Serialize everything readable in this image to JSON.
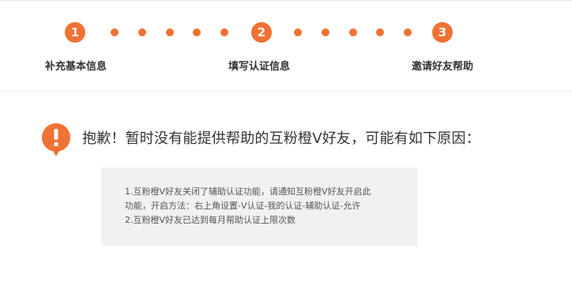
{
  "steps": [
    {
      "number": "1",
      "label": "补充基本信息"
    },
    {
      "number": "2",
      "label": "填写认证信息"
    },
    {
      "number": "3",
      "label": "邀请好友帮助"
    }
  ],
  "colors": {
    "accent": "#f07234",
    "text": "#333333",
    "box_bg": "#f1f1f3"
  },
  "message": {
    "icon": "exclamation-icon",
    "apology": "抱歉！暂时没有能提供帮助的互粉橙V好友，可能有如下原因："
  },
  "reasons": {
    "line1": "1.互粉橙V好友关闭了辅助认证功能，请通知互粉橙V好友开启此",
    "line2": "功能，开启方法：右上角设置-V认证-我的认证-辅助认证-允许",
    "line3": "2.互粉橙V好友已达到每月帮助认证上限次数"
  }
}
